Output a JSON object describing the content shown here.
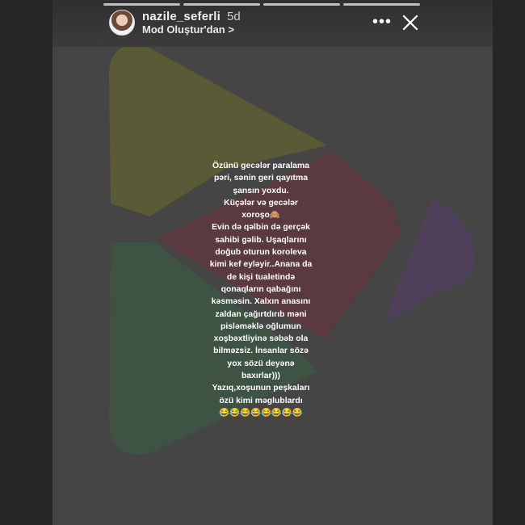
{
  "header": {
    "username": "nazile_seferli",
    "age": "5d",
    "subtitle": "Mod Oluştur'dan >",
    "more_icon": "more-horizontal-icon",
    "close_icon": "close-icon",
    "progress_segments": 4
  },
  "story": {
    "text": "Özünü gecələr paralama\npəri, sənin geri qayıtma\nşansın yoxdu.\nKüçələr və gecələr\nxoroşo🙈\nEvin də qəlbin də gerçək\nsahibi gəlib. Uşaqlarını\ndoğub oturun koroleva\nkimi kef eyləyir..Anana da\nde kişi tualetində\nqonaqların qabağını\nkəsməsin. Xalxın anasını\nzaldan çağırtdırıb məni\npisləməklə oğlumun\nxoşbəxtliyinə səbəb ola\nbilməzsiz. İnsanlar sözə\nyox sözü deyənə\nbaxırlar)))\nYazıq,xoşunun peşkaları\nözü kimi məglublardı\n😂😂😂😂😂😂😂😂",
    "background_colors": {
      "yellow": "#5b5a36",
      "red": "#5a3a3e",
      "green": "#3e5344",
      "purple": "#4e3f5a",
      "base": "#454545"
    }
  }
}
